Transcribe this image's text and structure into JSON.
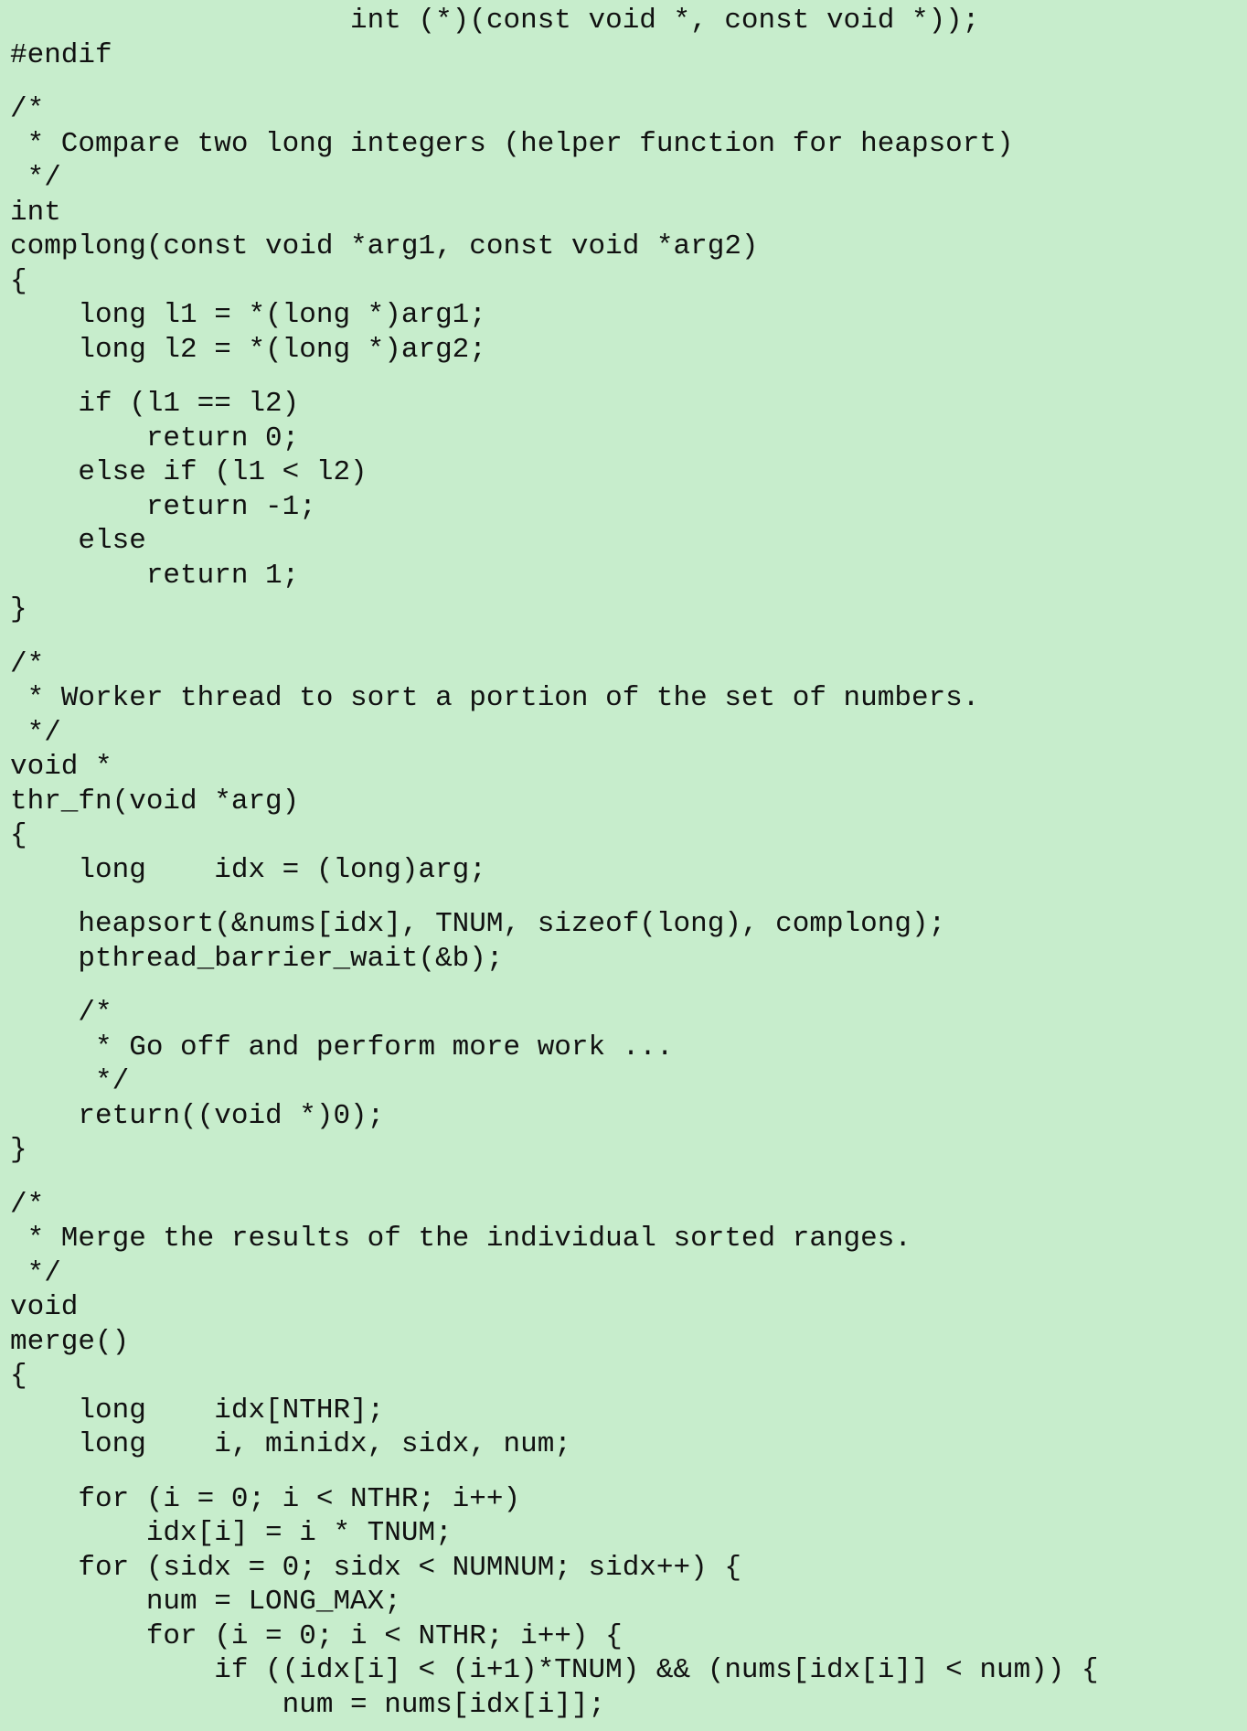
{
  "code": {
    "lines": [
      {
        "text": "                    int (*)(const void *, const void *));",
        "gap": false
      },
      {
        "text": "#endif",
        "gap": false
      },
      {
        "text": "/*",
        "gap": true
      },
      {
        "text": " * Compare two long integers (helper function for heapsort)",
        "gap": false
      },
      {
        "text": " */",
        "gap": false
      },
      {
        "text": "int",
        "gap": false
      },
      {
        "text": "complong(const void *arg1, const void *arg2)",
        "gap": false
      },
      {
        "text": "{",
        "gap": false
      },
      {
        "text": "    long l1 = *(long *)arg1;",
        "gap": false
      },
      {
        "text": "    long l2 = *(long *)arg2;",
        "gap": false
      },
      {
        "text": "    if (l1 == l2)",
        "gap": true
      },
      {
        "text": "        return 0;",
        "gap": false
      },
      {
        "text": "    else if (l1 < l2)",
        "gap": false
      },
      {
        "text": "        return -1;",
        "gap": false
      },
      {
        "text": "    else",
        "gap": false
      },
      {
        "text": "        return 1;",
        "gap": false
      },
      {
        "text": "}",
        "gap": false
      },
      {
        "text": "/*",
        "gap": true
      },
      {
        "text": " * Worker thread to sort a portion of the set of numbers.",
        "gap": false
      },
      {
        "text": " */",
        "gap": false
      },
      {
        "text": "void *",
        "gap": false
      },
      {
        "text": "thr_fn(void *arg)",
        "gap": false
      },
      {
        "text": "{",
        "gap": false
      },
      {
        "text": "    long    idx = (long)arg;",
        "gap": false
      },
      {
        "text": "    heapsort(&nums[idx], TNUM, sizeof(long), complong);",
        "gap": true
      },
      {
        "text": "    pthread_barrier_wait(&b);",
        "gap": false
      },
      {
        "text": "    /*",
        "gap": true
      },
      {
        "text": "     * Go off and perform more work ...",
        "gap": false
      },
      {
        "text": "     */",
        "gap": false
      },
      {
        "text": "    return((void *)0);",
        "gap": false
      },
      {
        "text": "}",
        "gap": false
      },
      {
        "text": "/*",
        "gap": true
      },
      {
        "text": " * Merge the results of the individual sorted ranges.",
        "gap": false
      },
      {
        "text": " */",
        "gap": false
      },
      {
        "text": "void",
        "gap": false
      },
      {
        "text": "merge()",
        "gap": false
      },
      {
        "text": "{",
        "gap": false
      },
      {
        "text": "    long    idx[NTHR];",
        "gap": false
      },
      {
        "text": "    long    i, minidx, sidx, num;",
        "gap": false
      },
      {
        "text": "    for (i = 0; i < NTHR; i++)",
        "gap": true
      },
      {
        "text": "        idx[i] = i * TNUM;",
        "gap": false
      },
      {
        "text": "    for (sidx = 0; sidx < NUMNUM; sidx++) {",
        "gap": false
      },
      {
        "text": "        num = LONG_MAX;",
        "gap": false
      },
      {
        "text": "        for (i = 0; i < NTHR; i++) {",
        "gap": false
      },
      {
        "text": "            if ((idx[i] < (i+1)*TNUM) && (nums[idx[i]] < num)) {",
        "gap": false
      },
      {
        "text": "                num = nums[idx[i]];",
        "gap": false
      }
    ]
  },
  "colors": {
    "background": "#c7edcc",
    "text": "#111111"
  }
}
